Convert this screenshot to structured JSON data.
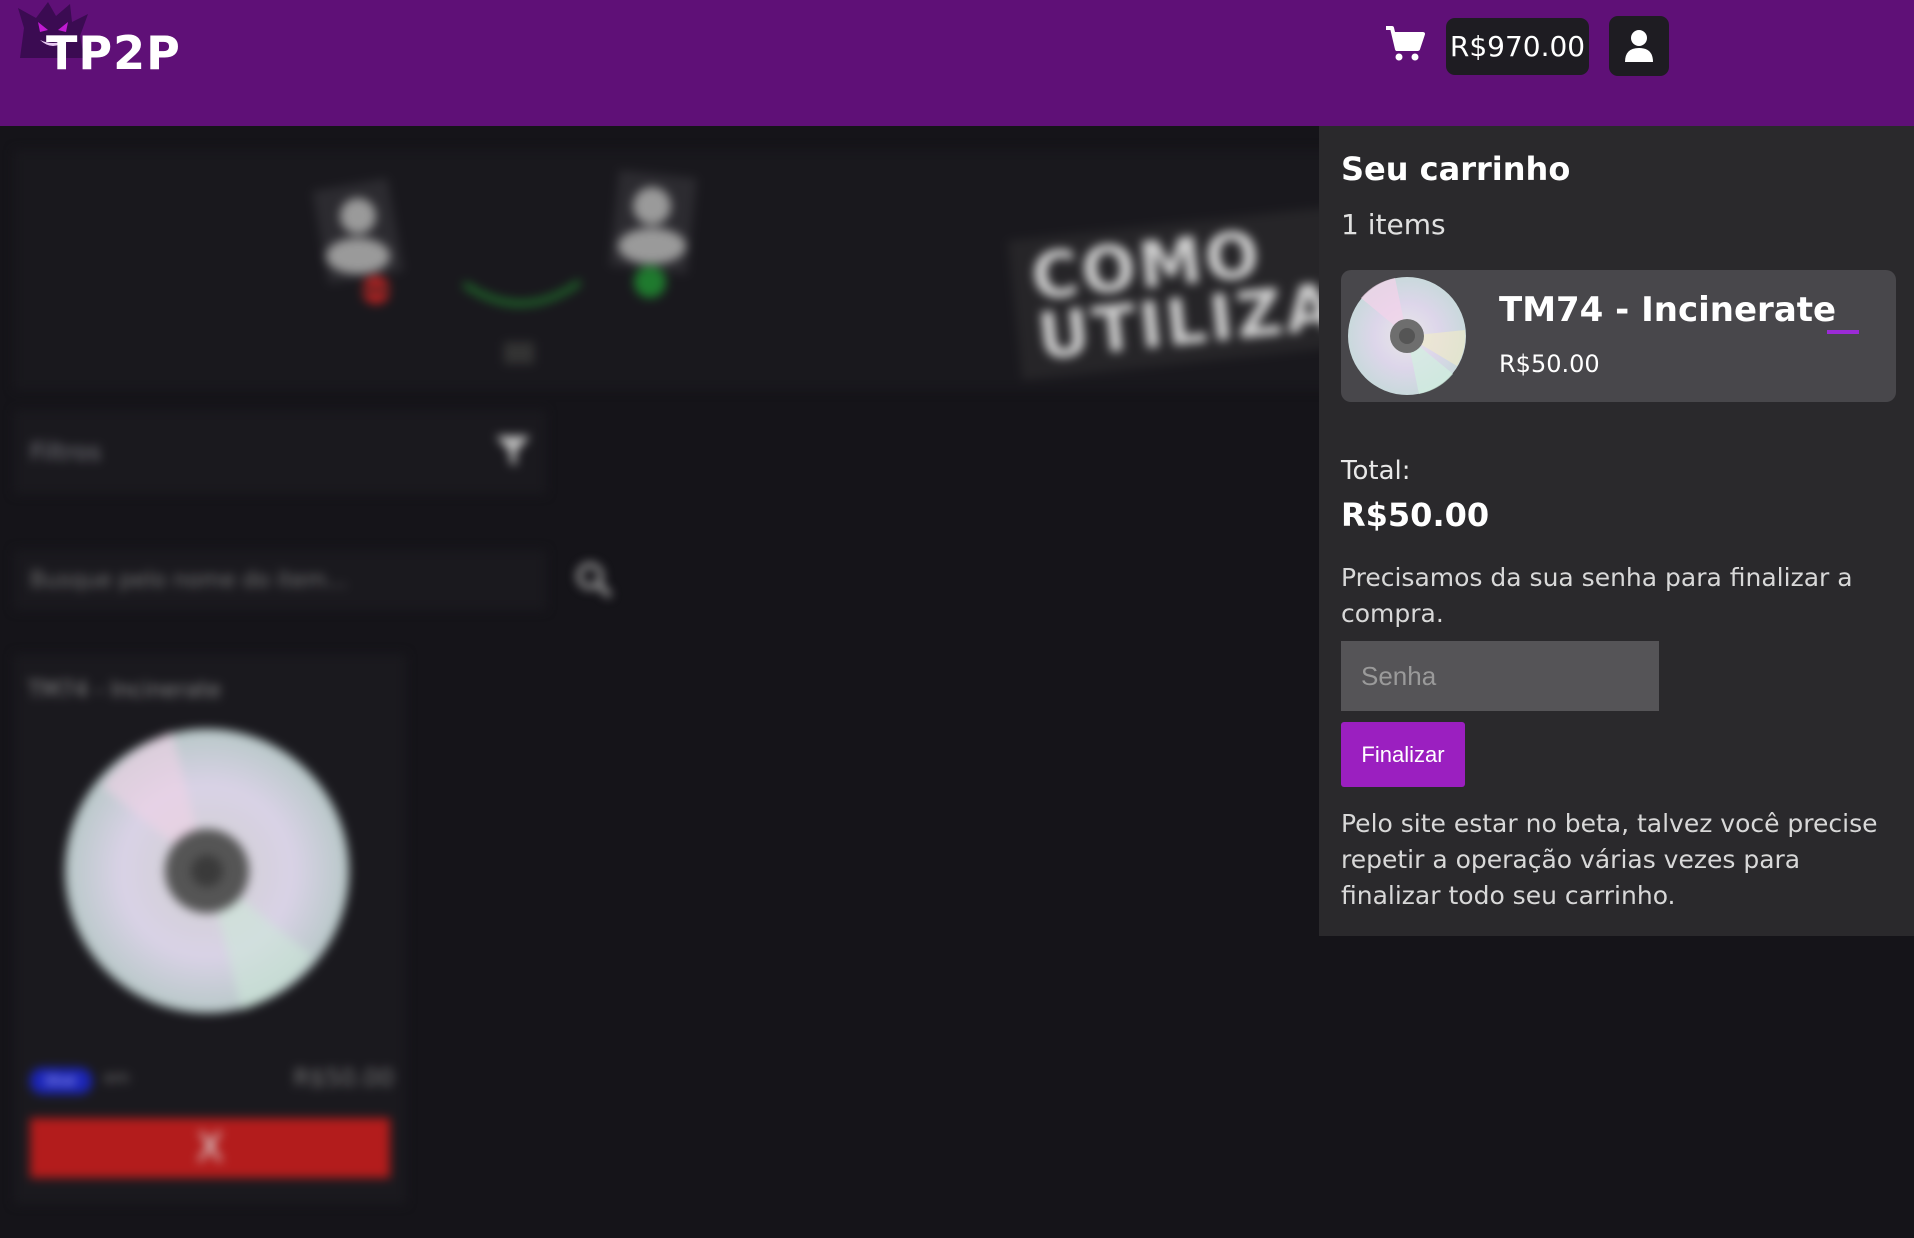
{
  "header": {
    "logo_text": "TP2P",
    "balance": "R$970.00"
  },
  "background": {
    "banner_text_line1": "COMO",
    "banner_text_line2": "UTILIZAR",
    "filters_label": "Filtros",
    "search_placeholder": "Busque pelo nome do item...",
    "card": {
      "title": "TM74 - Incinerate",
      "tag": "blue",
      "sub": "em",
      "price": "R$50.00",
      "remove_label": "X"
    }
  },
  "cart": {
    "title": "Seu carrinho",
    "count": "1 items",
    "items": [
      {
        "name": "TM74 - Incinerate",
        "price": "R$50.00"
      }
    ],
    "total_label": "Total:",
    "total_value": "R$50.00",
    "password_prompt": "Precisamos da sua senha para finalizar a compra.",
    "password_placeholder": "Senha",
    "finish_label": "Finalizar",
    "beta_note": "Pelo site estar no beta, talvez você precise repetir a operação várias vezes para finalizar todo seu carrinho."
  },
  "colors": {
    "header_bg": "#5f1077",
    "page_bg": "#151419",
    "panel_bg": "#2a292c",
    "accent": "#9b1fc0"
  }
}
